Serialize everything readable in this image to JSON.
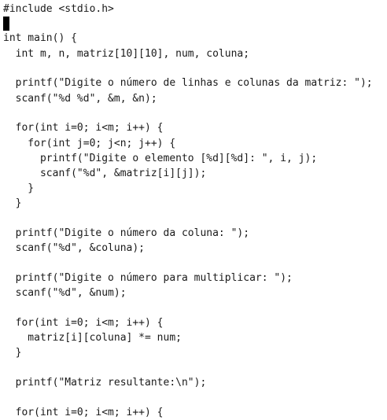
{
  "editor": {
    "lines": [
      "#include <stdio.h>",
      "",
      "int main() {",
      "  int m, n, matriz[10][10], num, coluna;",
      "",
      "  printf(\"Digite o número de linhas e colunas da matriz: \");",
      "  scanf(\"%d %d\", &m, &n);",
      "",
      "  for(int i=0; i<m; i++) {",
      "    for(int j=0; j<n; j++) {",
      "      printf(\"Digite o elemento [%d][%d]: \", i, j);",
      "      scanf(\"%d\", &matriz[i][j]);",
      "    }",
      "  }",
      "",
      "  printf(\"Digite o número da coluna: \");",
      "  scanf(\"%d\", &coluna);",
      "",
      "  printf(\"Digite o número para multiplicar: \");",
      "  scanf(\"%d\", &num);",
      "",
      "  for(int i=0; i<m; i++) {",
      "    matriz[i][coluna] *= num;",
      "  }",
      "",
      "  printf(\"Matriz resultante:\\n\");",
      "",
      "  for(int i=0; i<m; i++) {"
    ]
  }
}
